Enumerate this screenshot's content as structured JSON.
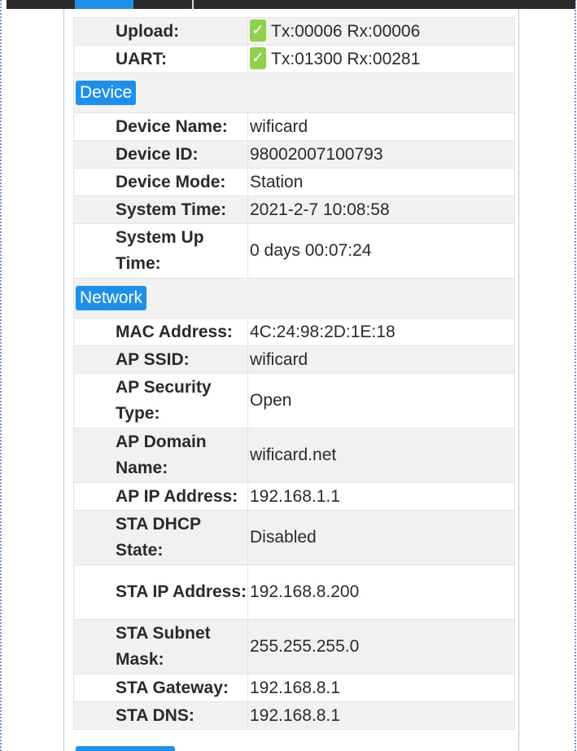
{
  "status": {
    "rows": [
      {
        "label": "Upload:",
        "value": "Tx:00006 Rx:00006",
        "icon": "check-icon"
      },
      {
        "label": "UART:",
        "value": "Tx:01300 Rx:00281",
        "icon": "check-icon"
      }
    ]
  },
  "device": {
    "heading": "Device",
    "rows": [
      {
        "label": "Device Name:",
        "value": "wificard"
      },
      {
        "label": "Device ID:",
        "value": "98002007100793"
      },
      {
        "label": "Device Mode:",
        "value": "Station"
      },
      {
        "label": "System Time:",
        "value": "2021-2-7 10:08:58"
      },
      {
        "label": "System Up Time:",
        "value": "0 days 00:07:24"
      }
    ]
  },
  "network": {
    "heading": "Network",
    "rows": [
      {
        "label": "MAC Address:",
        "value": "4C:24:98:2D:1E:18"
      },
      {
        "label": "AP SSID:",
        "value": "wificard"
      },
      {
        "label": "AP Security Type:",
        "value": "Open"
      },
      {
        "label": "AP Domain Name:",
        "value": "wificard.net"
      },
      {
        "label": "AP IP Address:",
        "value": "192.168.1.1"
      },
      {
        "label": "STA DHCP State:",
        "value": "Disabled"
      },
      {
        "label": "STA IP Address:",
        "value": "192.168.8.200"
      },
      {
        "label": "STA Subnet Mask:",
        "value": "255.255.255.0"
      },
      {
        "label": "STA Gateway:",
        "value": "192.168.8.1"
      },
      {
        "label": "STA DNS:",
        "value": "192.168.8.1"
      }
    ]
  },
  "colors": {
    "accent": "#1e90e8",
    "check": "#8fd14f",
    "row_alt": "#f1f1f1"
  }
}
